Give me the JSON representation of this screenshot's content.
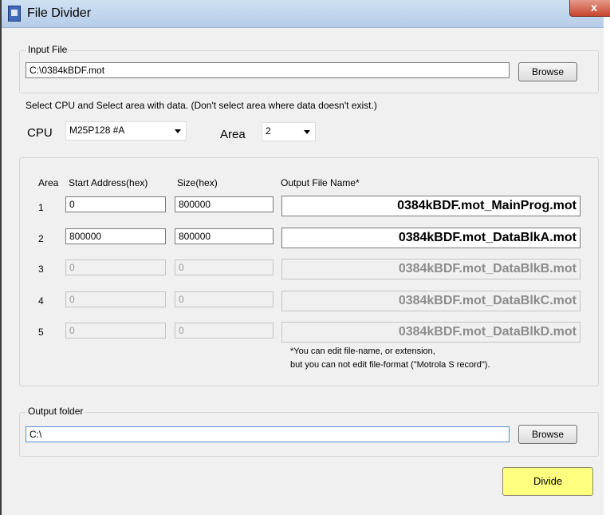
{
  "window": {
    "title": "File Divider",
    "close_label": "x"
  },
  "input_file": {
    "legend": "Input File",
    "path": "C:\\0384kBDF.mot",
    "browse_label": "Browse"
  },
  "instruction": "Select CPU and Select area with data.  (Don't select area where data doesn't exist.)",
  "cpu": {
    "label": "CPU",
    "value": "M25P128 #A"
  },
  "area_select": {
    "label": "Area",
    "value": "2"
  },
  "table": {
    "headers": {
      "area": "Area",
      "start": "Start Address(hex)",
      "size": "Size(hex)",
      "output": "Output File Name*"
    },
    "rows": [
      {
        "area": "1",
        "start": "0",
        "size": "800000",
        "output": "0384kBDF.mot_MainProg.mot",
        "enabled": true
      },
      {
        "area": "2",
        "start": "800000",
        "size": "800000",
        "output": "0384kBDF.mot_DataBlkA.mot",
        "enabled": true
      },
      {
        "area": "3",
        "start": "0",
        "size": "0",
        "output": "0384kBDF.mot_DataBlkB.mot",
        "enabled": false
      },
      {
        "area": "4",
        "start": "0",
        "size": "0",
        "output": "0384kBDF.mot_DataBlkC.mot",
        "enabled": false
      },
      {
        "area": "5",
        "start": "0",
        "size": "0",
        "output": "0384kBDF.mot_DataBlkD.mot",
        "enabled": false
      }
    ],
    "note_line1": "*You can edit file-name, or extension,",
    "note_line2": "but you can not edit file-format (\"Motrola S record\")."
  },
  "output_folder": {
    "legend": "Output folder",
    "path": "C:\\",
    "browse_label": "Browse"
  },
  "divide_label": "Divide",
  "colors": {
    "divide_button": "#ffff80",
    "title_bar": "#c4d7ee",
    "close_button": "#c7462f"
  }
}
